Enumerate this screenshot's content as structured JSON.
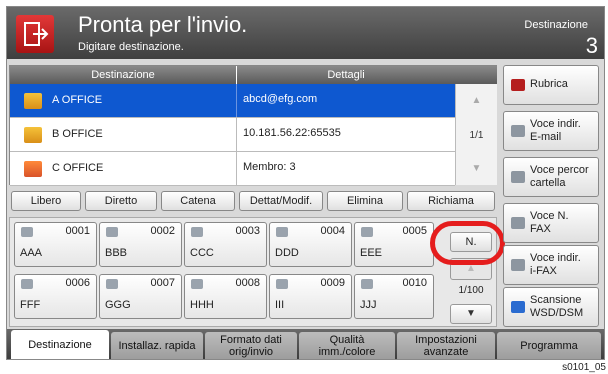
{
  "header": {
    "title": "Pronta per l'invio.",
    "subtitle": "Digitare destinazione.",
    "dest_label": "Destinazione",
    "dest_count": "3"
  },
  "table": {
    "col_dest": "Destinazione",
    "col_det": "Dettagli",
    "rows": [
      {
        "name": "A OFFICE",
        "detail": "abcd@efg.com"
      },
      {
        "name": "B OFFICE",
        "detail": "10.181.56.22:65535"
      },
      {
        "name": "C OFFICE",
        "detail": "Membro:    3"
      }
    ],
    "page": "1/1"
  },
  "toolbar": {
    "libero": "Libero",
    "diretto": "Diretto",
    "catena": "Catena",
    "dettmod": "Dettat/Modif.",
    "elimina": "Elimina",
    "richiama": "Richiama"
  },
  "keys": [
    {
      "num": "0001",
      "label": "AAA"
    },
    {
      "num": "0002",
      "label": "BBB"
    },
    {
      "num": "0003",
      "label": "CCC"
    },
    {
      "num": "0004",
      "label": "DDD"
    },
    {
      "num": "0005",
      "label": "EEE"
    },
    {
      "num": "0006",
      "label": "FFF"
    },
    {
      "num": "0007",
      "label": "GGG"
    },
    {
      "num": "0008",
      "label": "HHH"
    },
    {
      "num": "0009",
      "label": "III"
    },
    {
      "num": "0010",
      "label": "JJJ"
    }
  ],
  "nav": {
    "n_label": "N.",
    "page": "1/100"
  },
  "right": {
    "rubrica": "Rubrica",
    "email_l1": "Voce indir.",
    "email_l2": "E-mail",
    "cart_l1": "Voce percor",
    "cart_l2": "cartella",
    "fax_l1": "Voce N.",
    "fax_l2": "FAX",
    "ifax_l1": "Voce indir.",
    "ifax_l2": "i-FAX",
    "wsd_l1": "Scansione",
    "wsd_l2": "WSD/DSM"
  },
  "tabs": {
    "t1": "Destinazione",
    "t2": "Installaz. rapida",
    "t3_l1": "Formato dati",
    "t3_l2": "orig/invio",
    "t4_l1": "Qualità",
    "t4_l2": "imm./colore",
    "t5_l1": "Impostazioni",
    "t5_l2": "avanzate",
    "t6": "Programma"
  },
  "footer": "s0101_05",
  "colors": {
    "selected_row": "#0e58d0",
    "highlight_circle": "#e51d1d",
    "header": "#4a4a4a"
  }
}
